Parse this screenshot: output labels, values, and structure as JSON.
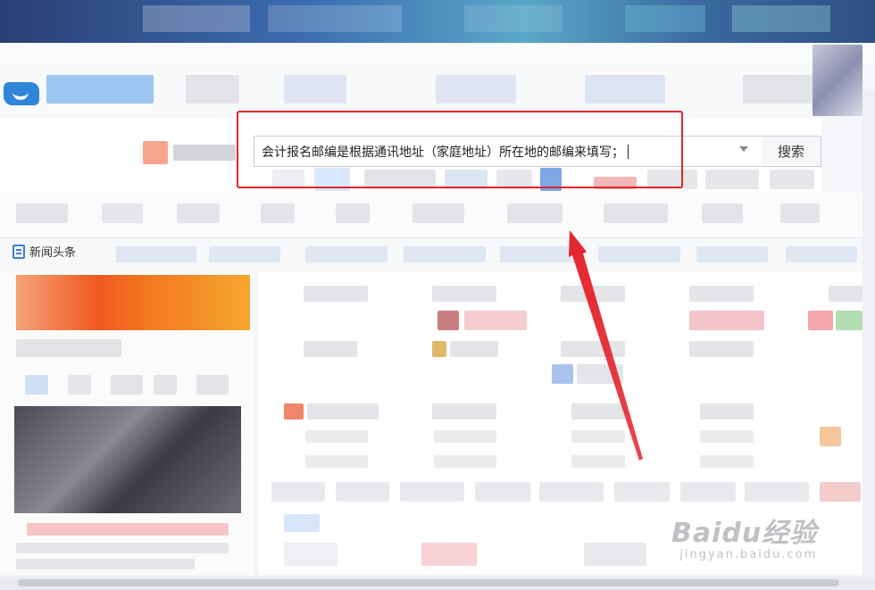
{
  "search": {
    "query": "会计报名邮编是根据通讯地址（家庭地址）所在地的邮编来填写；",
    "button_label": "搜索"
  },
  "tabs": {
    "news_label": "新闻头条"
  },
  "annotation": {
    "box_color": "#e0262c",
    "arrow_color": "#e0262c"
  },
  "watermark": {
    "main": "Baidu经验",
    "sub": "jingyan.baidu.com"
  }
}
